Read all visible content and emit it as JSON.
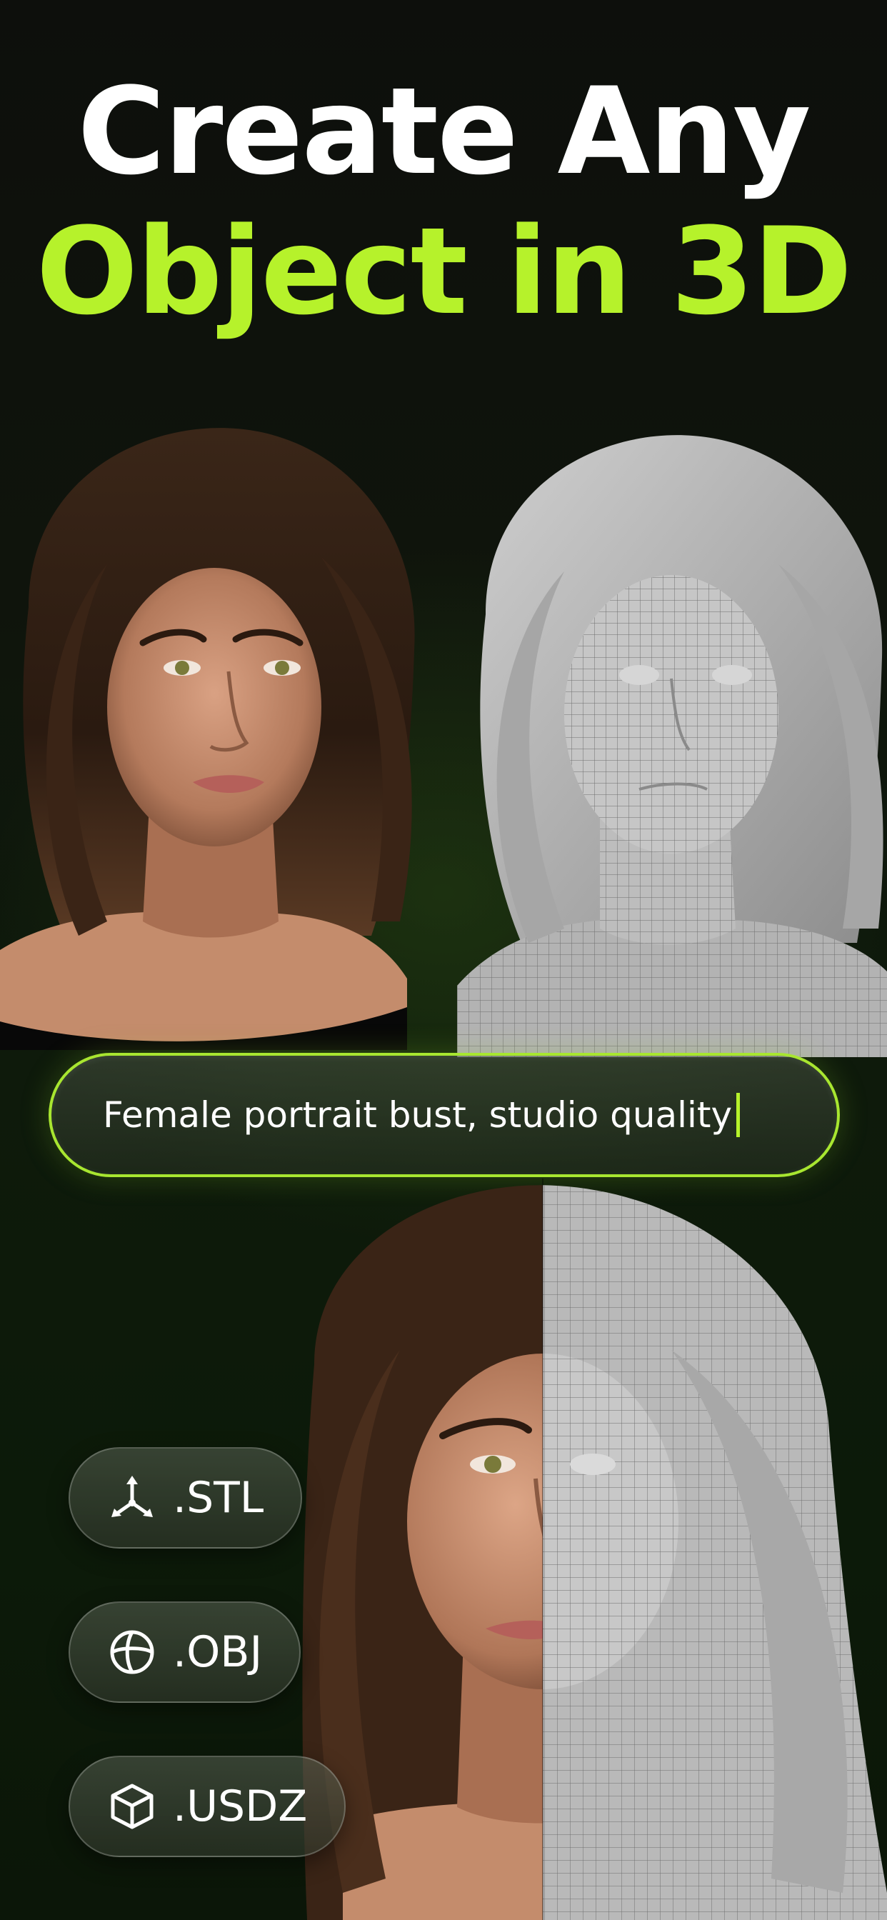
{
  "headline": {
    "line1": "Create Any",
    "line2": "Object in 3D"
  },
  "prompt": {
    "text": "Female portrait bust, studio quality"
  },
  "formats": [
    {
      "label": ".STL",
      "icon": "axes-icon"
    },
    {
      "label": ".OBJ",
      "icon": "sphere-icon"
    },
    {
      "label": ".USDZ",
      "icon": "cube-icon"
    }
  ],
  "colors": {
    "accent": "#b6f22b",
    "background": "#0b0d0a"
  }
}
